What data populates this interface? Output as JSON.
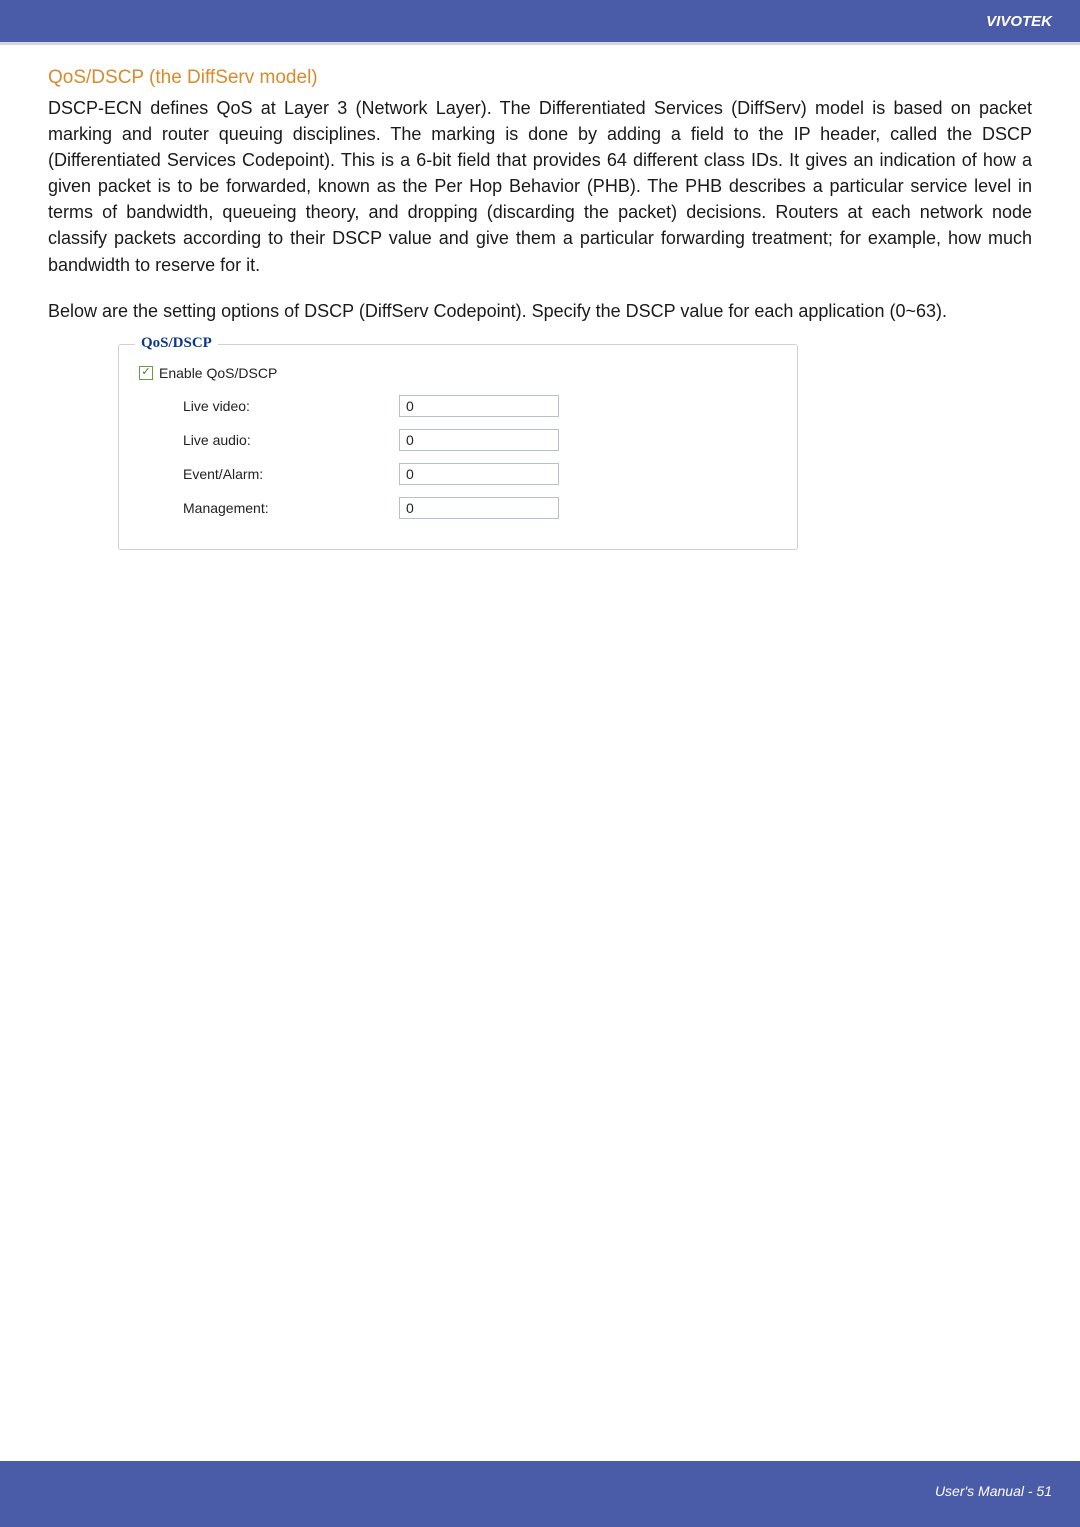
{
  "header": {
    "brand": "VIVOTEK"
  },
  "section": {
    "heading": "QoS/DSCP (the DiffServ model)",
    "paragraph1": "DSCP-ECN defines QoS at Layer 3 (Network Layer). The Differentiated Services (DiffServ) model is based on packet marking and router queuing disciplines. The marking is done by adding a field to the IP header, called the DSCP (Differentiated Services Codepoint). This is a 6-bit field that provides 64 different class IDs. It gives an indication of how a given packet is to be forwarded, known as the Per Hop Behavior (PHB). The PHB describes a particular service level in terms of bandwidth, queueing theory, and dropping (discarding the packet) decisions. Routers at each network node classify packets according to their DSCP value and give them a particular forwarding treatment; for example, how much bandwidth to reserve for it.",
    "paragraph2": "Below are the setting options of DSCP (DiffServ Codepoint). Specify the DSCP value for each application (0~63)."
  },
  "panel": {
    "legend": "QoS/DSCP",
    "checkbox_label": "Enable QoS/DSCP",
    "fields": {
      "live_video": {
        "label": "Live video:",
        "value": "0"
      },
      "live_audio": {
        "label": "Live audio:",
        "value": "0"
      },
      "event_alarm": {
        "label": "Event/Alarm:",
        "value": "0"
      },
      "management": {
        "label": "Management:",
        "value": "0"
      }
    }
  },
  "footer": {
    "text": "User's Manual - 51"
  }
}
